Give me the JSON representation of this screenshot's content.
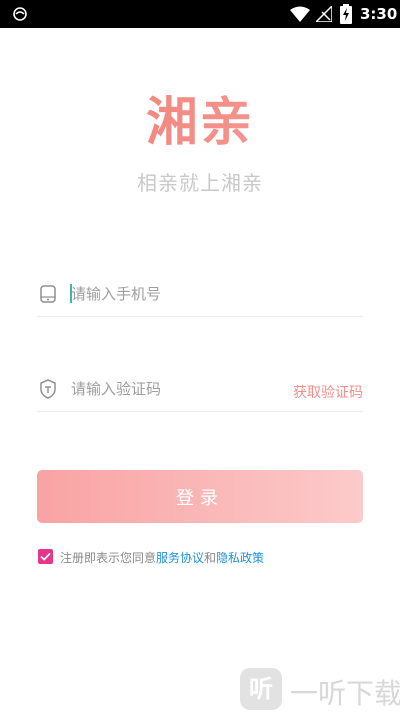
{
  "status_bar": {
    "time": "3:30",
    "icons": [
      "notification-icon",
      "wifi-icon",
      "no-signal-icon",
      "battery-charging-icon"
    ]
  },
  "logo": {
    "text": "湘亲"
  },
  "slogan": "相亲就上湘亲",
  "phone_field": {
    "placeholder": "请输入手机号",
    "value": "",
    "icon": "phone-icon"
  },
  "code_field": {
    "placeholder": "请输入验证码",
    "value": "",
    "icon": "shield-icon",
    "get_code_label": "获取验证码"
  },
  "login_button": {
    "label": "登录"
  },
  "agreement": {
    "checked": true,
    "prefix": "注册即表示您同意",
    "service_link": "服务协议",
    "and": "和",
    "privacy_link": "隐私政策"
  },
  "watermark": {
    "glyph": "听",
    "text": "一听下载"
  },
  "colors": {
    "accent": "#f08f8c",
    "button_start": "#f9a3a3",
    "button_end": "#fccaca",
    "checkbox": "#e8358a",
    "link": "#1f92d8"
  }
}
